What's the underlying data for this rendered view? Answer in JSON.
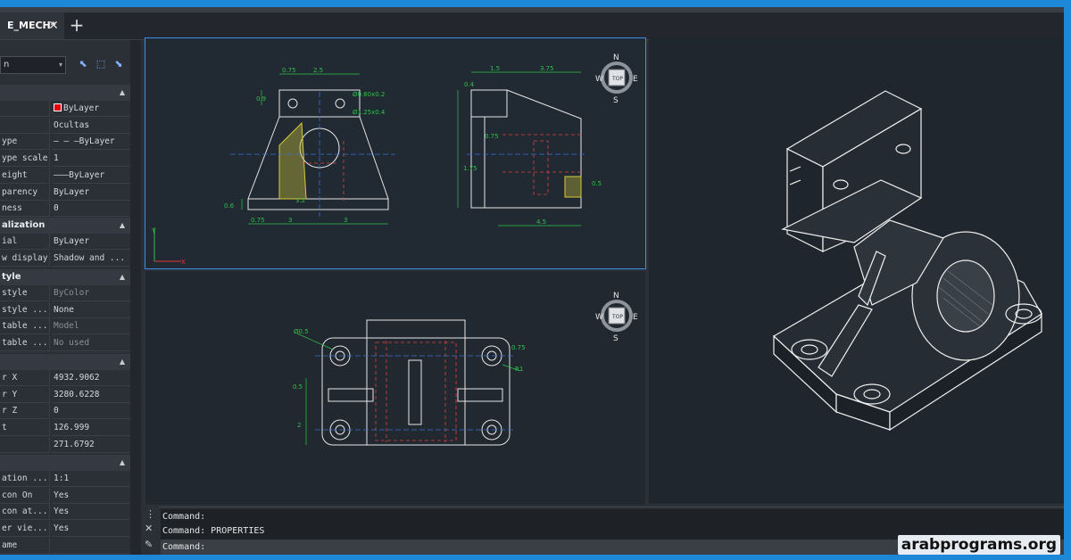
{
  "document": {
    "tab_title": "E_MECH*"
  },
  "properties": {
    "selector_value": "n",
    "general_rows": [
      {
        "key": "",
        "value": "ByLayer",
        "swatch": "#e00000"
      },
      {
        "key": "",
        "value": "Ocultas"
      },
      {
        "key": "ype",
        "value": "— — —ByLayer"
      },
      {
        "key": "ype scale",
        "value": "1"
      },
      {
        "key": "eight",
        "value": "———ByLayer"
      },
      {
        "key": "parency",
        "value": "ByLayer"
      },
      {
        "key": "ness",
        "value": "0"
      }
    ],
    "visualization_header": "alization",
    "visualization_rows": [
      {
        "key": "ial",
        "value": "ByLayer"
      },
      {
        "key": "w display",
        "value": "Shadow and ..."
      }
    ],
    "style_header": "tyle",
    "style_rows": [
      {
        "key": "style",
        "value": "ByColor",
        "dim": true
      },
      {
        "key": "style ...",
        "value": "None"
      },
      {
        "key": "table ...",
        "value": "Model",
        "dim": true
      },
      {
        "key": "table ...",
        "value": "No used",
        "dim": true
      }
    ],
    "geometry_rows": [
      {
        "key": "r X",
        "value": "4932.9062"
      },
      {
        "key": "r Y",
        "value": "3280.6228"
      },
      {
        "key": "r Z",
        "value": "0"
      },
      {
        "key": "t",
        "value": "126.999"
      },
      {
        "key": "",
        "value": "271.6792"
      }
    ],
    "misc_rows": [
      {
        "key": "ation ...",
        "value": "1:1"
      },
      {
        "key": "con On",
        "value": "Yes"
      },
      {
        "key": "con at...",
        "value": "Yes"
      },
      {
        "key": "er vie...",
        "value": "Yes"
      },
      {
        "key": "ame",
        "value": ""
      }
    ]
  },
  "viewcube": {
    "top": "TOP",
    "n": "N",
    "s": "S",
    "e": "E",
    "w": "W"
  },
  "drawing": {
    "front_dims": [
      "0.75",
      "2.5",
      "0.9",
      "0.6",
      "3",
      "3",
      "0.75",
      "3.2",
      "Ø0.60x0.2",
      "Ø1.25x0.4"
    ],
    "side_dims": [
      "1.5",
      "3.75",
      "0.4",
      "0.75",
      "1.75",
      "4.5",
      "0.5",
      "1.75"
    ],
    "top_dims": [
      "Ø0.5",
      "0.5",
      "2",
      "R1",
      "0.75"
    ]
  },
  "command_lines": [
    "Command:",
    "Command:  PROPERTIES",
    "Command:"
  ],
  "watermark": "arabprograms.org"
}
